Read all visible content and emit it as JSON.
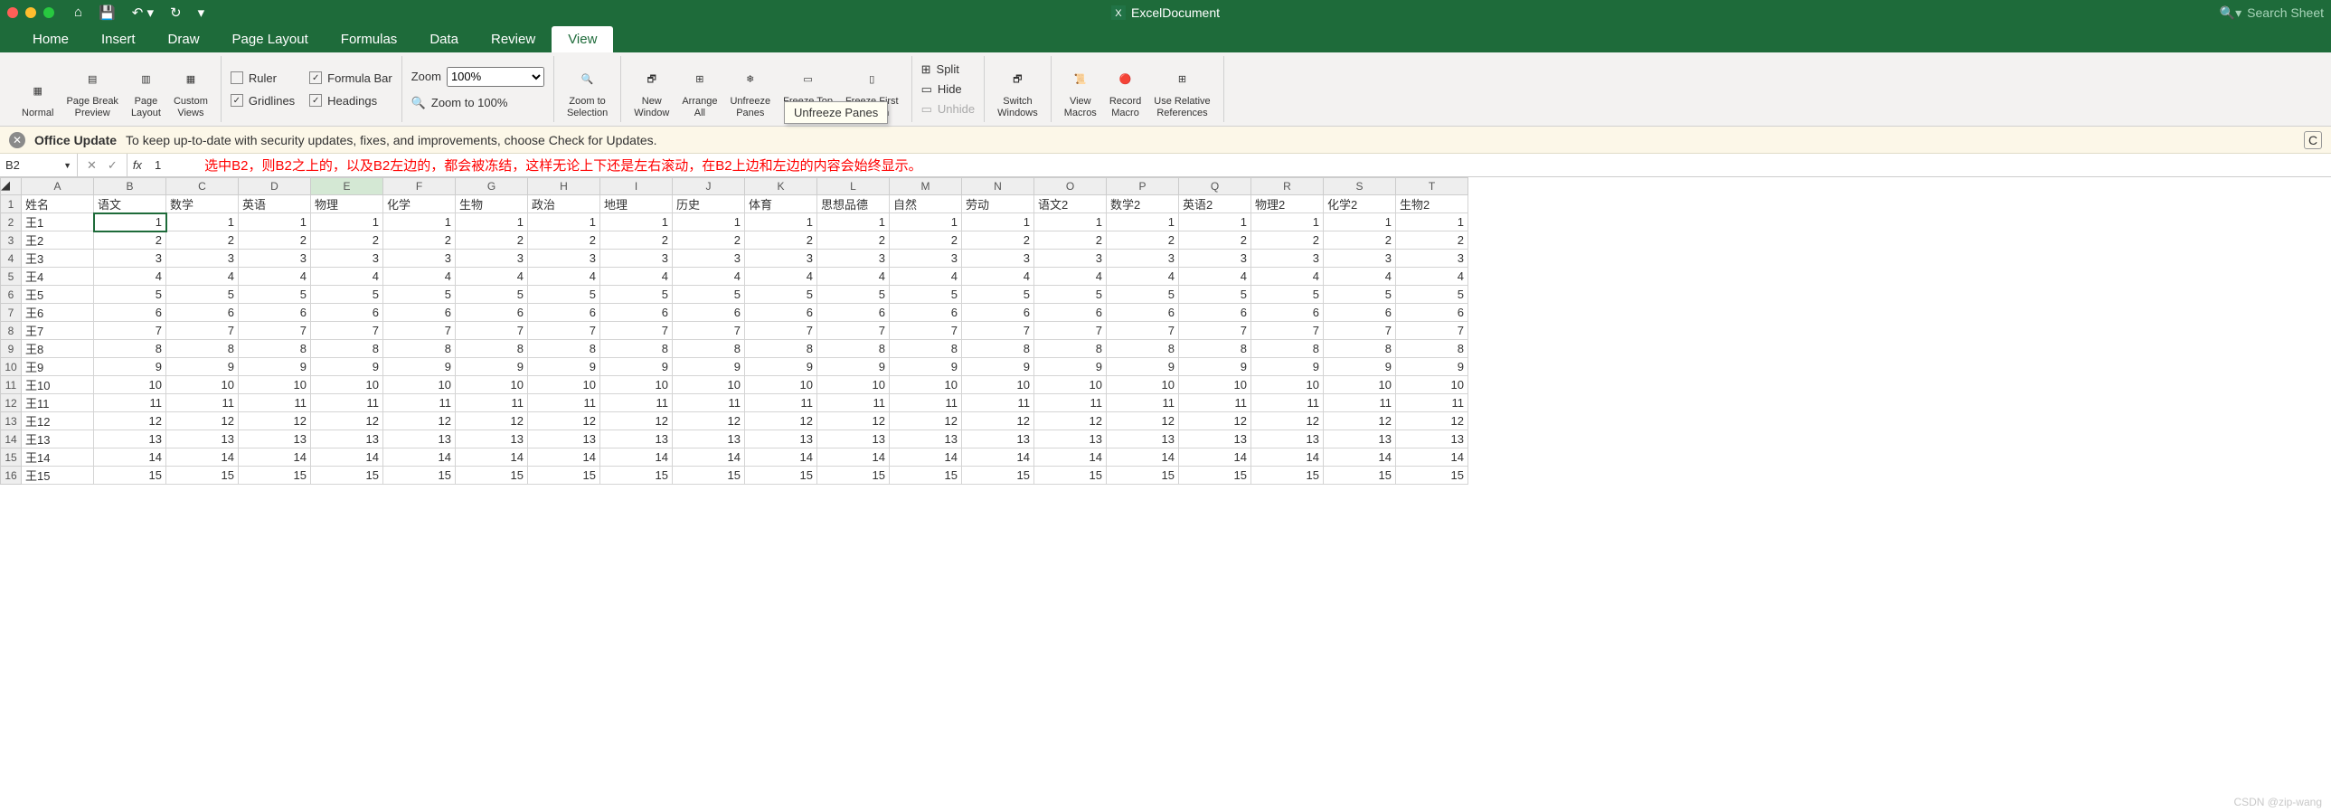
{
  "titlebar": {
    "document_name": "ExcelDocument",
    "search_placeholder": "Search Sheet"
  },
  "menu_tabs": [
    "Home",
    "Insert",
    "Draw",
    "Page Layout",
    "Formulas",
    "Data",
    "Review",
    "View"
  ],
  "active_tab": "View",
  "ribbon": {
    "views": [
      "Normal",
      "Page Break\nPreview",
      "Page\nLayout",
      "Custom\nViews"
    ],
    "checks": {
      "ruler": "Ruler",
      "formula_bar": "Formula Bar",
      "gridlines": "Gridlines",
      "headings": "Headings"
    },
    "zoom_label": "Zoom",
    "zoom_value": "100%",
    "zoom_100": "Zoom to 100%",
    "zoom_sel": "Zoom to\nSelection",
    "window": [
      "New\nWindow",
      "Arrange\nAll",
      "Unfreeze\nPanes",
      "Freeze Top\nRow",
      "Freeze First\nColumn"
    ],
    "split": "Split",
    "hide": "Hide",
    "unhide": "Unhide",
    "switch": "Switch\nWindows",
    "macros": "View\nMacros",
    "record": "Record\nMacro",
    "relref": "Use Relative\nReferences",
    "tooltip": "Unfreeze Panes"
  },
  "update_bar": {
    "title": "Office Update",
    "msg": "To keep up-to-date with security updates, fixes, and improvements, choose Check for Updates.",
    "close": "C"
  },
  "formula_bar": {
    "name_box": "B2",
    "fx": "fx",
    "value": "1"
  },
  "annotation": "选中B2，则B2之上的，以及B2左边的，都会被冻结，这样无论上下还是左右滚动，在B2上边和左边的内容会始终显示。",
  "columns": [
    "A",
    "B",
    "C",
    "D",
    "E",
    "F",
    "G",
    "H",
    "I",
    "J",
    "K",
    "L",
    "M",
    "N",
    "O",
    "P",
    "Q",
    "R",
    "S",
    "T"
  ],
  "headers": [
    "姓名",
    "语文",
    "数学",
    "英语",
    "物理",
    "化学",
    "生物",
    "政治",
    "地理",
    "历史",
    "体育",
    "思想品德",
    "自然",
    "劳动",
    "语文2",
    "数学2",
    "英语2",
    "物理2",
    "化学2",
    "生物2"
  ],
  "rows": [
    {
      "n": 2,
      "name": "王1",
      "v": 1
    },
    {
      "n": 3,
      "name": "王2",
      "v": 2
    },
    {
      "n": 4,
      "name": "王3",
      "v": 3
    },
    {
      "n": 5,
      "name": "王4",
      "v": 4
    },
    {
      "n": 6,
      "name": "王5",
      "v": 5
    },
    {
      "n": 7,
      "name": "王6",
      "v": 6
    },
    {
      "n": 8,
      "name": "王7",
      "v": 7
    },
    {
      "n": 9,
      "name": "王8",
      "v": 8
    },
    {
      "n": 10,
      "name": "王9",
      "v": 9
    },
    {
      "n": 11,
      "name": "王10",
      "v": 10
    },
    {
      "n": 12,
      "name": "王11",
      "v": 11
    },
    {
      "n": 13,
      "name": "王12",
      "v": 12
    },
    {
      "n": 14,
      "name": "王13",
      "v": 13
    },
    {
      "n": 15,
      "name": "王14",
      "v": 14
    },
    {
      "n": 16,
      "name": "王15",
      "v": 15
    }
  ],
  "active_cell": "B2",
  "selected_col": "E",
  "watermark": "CSDN @zip-wang"
}
